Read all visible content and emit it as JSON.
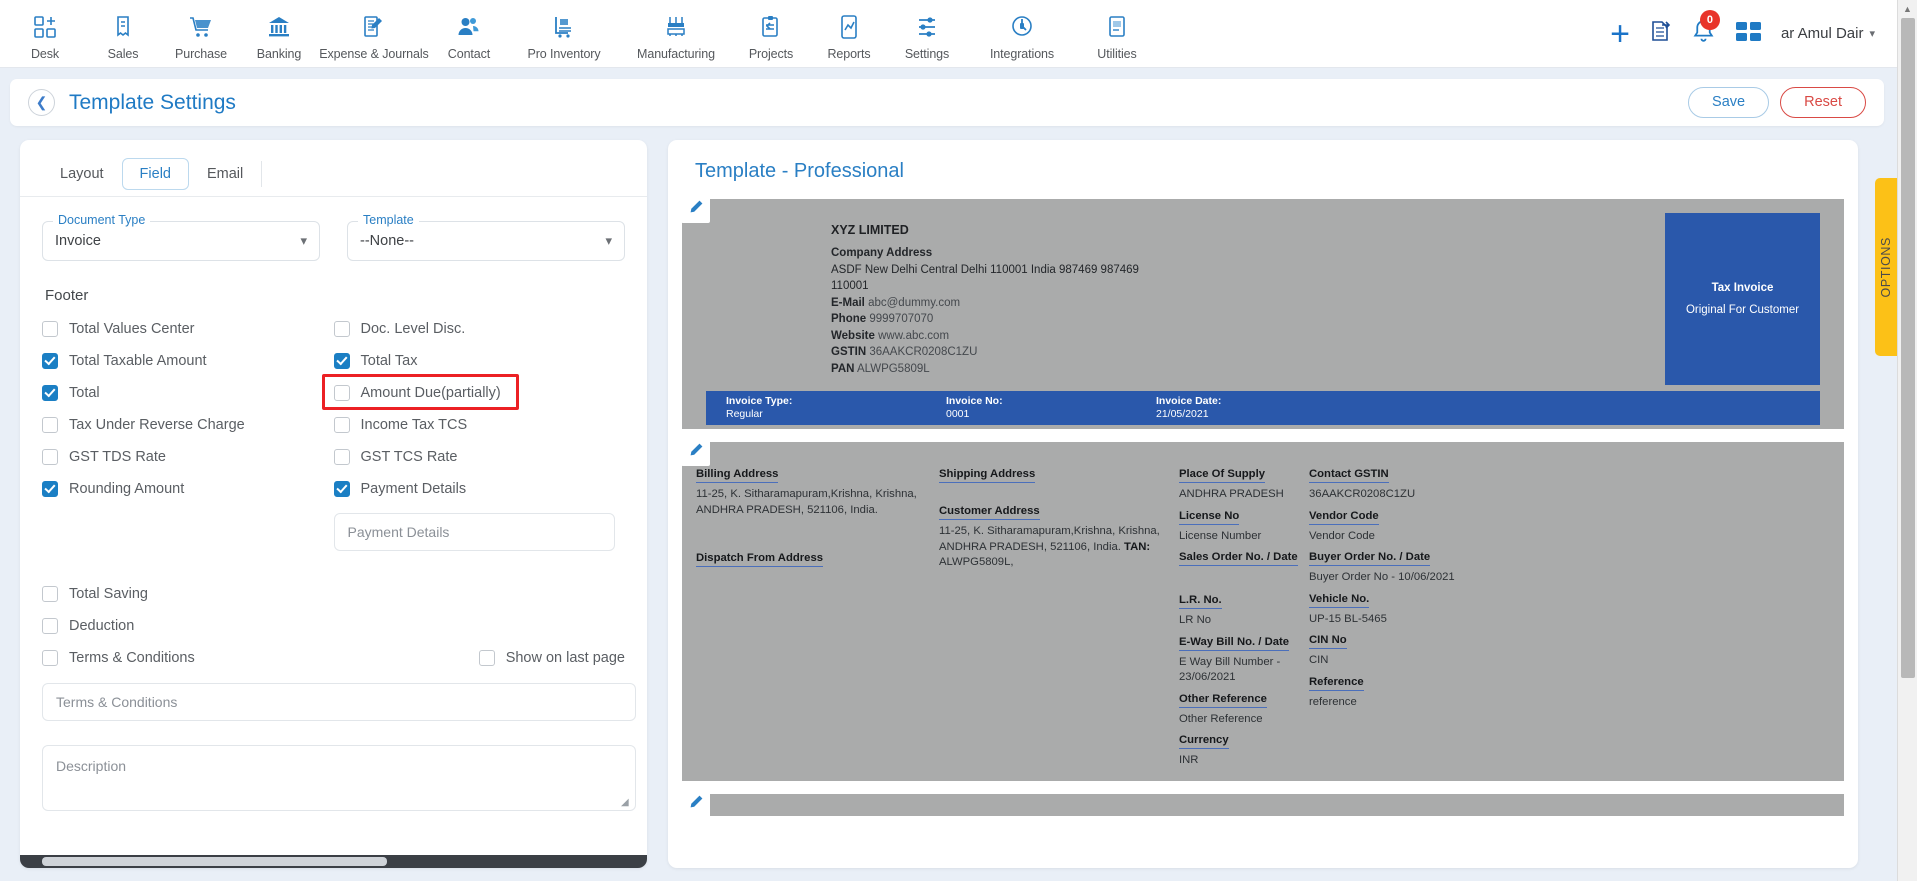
{
  "topnav": {
    "items": [
      {
        "label": "Desk",
        "icon": "desk-icon"
      },
      {
        "label": "Sales",
        "icon": "sales-icon"
      },
      {
        "label": "Purchase",
        "icon": "purchase-cart-icon"
      },
      {
        "label": "Banking",
        "icon": "bank-icon"
      },
      {
        "label": "Expense & Journals",
        "icon": "journal-icon"
      },
      {
        "label": "Contact",
        "icon": "contact-people-icon"
      },
      {
        "label": "Pro Inventory",
        "icon": "inventory-trolley-icon"
      },
      {
        "label": "Manufacturing",
        "icon": "manufacturing-icon"
      },
      {
        "label": "Projects",
        "icon": "projects-clipboard-icon"
      },
      {
        "label": "Reports",
        "icon": "reports-chart-icon"
      },
      {
        "label": "Settings",
        "icon": "settings-sliders-icon"
      },
      {
        "label": "Integrations",
        "icon": "integrations-plug-icon"
      },
      {
        "label": "Utilities",
        "icon": "utilities-icon"
      }
    ],
    "add_label": "+",
    "notification_count": "0",
    "user_name": "ar Amul Dair"
  },
  "header": {
    "title": "Template Settings",
    "save_label": "Save",
    "reset_label": "Reset"
  },
  "left_panel": {
    "tabs": [
      {
        "label": "Layout",
        "active": false
      },
      {
        "label": "Field",
        "active": true
      },
      {
        "label": "Email",
        "active": false
      }
    ],
    "document_type": {
      "legend": "Document Type",
      "value": "Invoice"
    },
    "template": {
      "legend": "Template",
      "value": "--None--"
    },
    "footer_section_title": "Footer",
    "checkboxes_left": [
      {
        "label": "Total Values Center",
        "checked": false
      },
      {
        "label": "Total Taxable Amount",
        "checked": true
      },
      {
        "label": "Total",
        "checked": true
      },
      {
        "label": "Tax Under Reverse Charge",
        "checked": false
      },
      {
        "label": "GST TDS Rate",
        "checked": false
      },
      {
        "label": "Rounding Amount",
        "checked": true
      }
    ],
    "checkboxes_right": [
      {
        "label": "Doc. Level Disc.",
        "checked": false
      },
      {
        "label": "Total Tax",
        "checked": true
      },
      {
        "label": "Amount Due(partially)",
        "checked": false,
        "highlighted": true
      },
      {
        "label": "Income Tax TCS",
        "checked": false
      },
      {
        "label": "GST TCS Rate",
        "checked": false
      },
      {
        "label": "Payment Details",
        "checked": true
      }
    ],
    "payment_details_input": "Payment Details",
    "checkboxes_lower": [
      {
        "label": "Total Saving",
        "checked": false
      },
      {
        "label": "Deduction",
        "checked": false
      },
      {
        "label": "Terms & Conditions",
        "checked": false
      }
    ],
    "show_on_last_page": {
      "label": "Show on last page",
      "checked": false
    },
    "terms_input": "Terms & Conditions",
    "description_input": "Description"
  },
  "preview": {
    "title": "Template - Professional",
    "company": {
      "name": "XYZ LIMITED",
      "address_label": "Company Address",
      "address_line1": "ASDF New Delhi Central Delhi 110001 India 987469 987469",
      "address_line2": "110001",
      "email_label": "E-Mail",
      "email_value": "abc@dummy.com",
      "phone_label": "Phone",
      "phone_value": "9999707070",
      "website_label": "Website",
      "website_value": "www.abc.com",
      "gstin_label": "GSTIN",
      "gstin_value": "36AAKCR0208C1ZU",
      "pan_label": "PAN",
      "pan_value": "ALWPG5809L"
    },
    "tax_box": {
      "line1": "Tax Invoice",
      "line2": "Original For Customer"
    },
    "invoice_bar": [
      {
        "key": "Invoice Type:",
        "value": "Regular"
      },
      {
        "key": "Invoice No:",
        "value": "0001"
      },
      {
        "key": "Invoice Date:",
        "value": "21/05/2021"
      }
    ],
    "billing": {
      "label": "Billing Address",
      "line1": "11-25, K. Sitharamapuram,Krishna, Krishna,",
      "line2": "ANDHRA PRADESH, 521106, India.",
      "dispatch_label": "Dispatch From Address"
    },
    "shipping": {
      "label": "Shipping Address",
      "customer_label": "Customer Address",
      "line1": "11-25, K. Sitharamapuram,Krishna, Krishna,",
      "line2": "ANDHRA PRADESH, 521106, India.",
      "tan_label": "TAN:",
      "tan_value": "ALWPG5809L,"
    },
    "col3": [
      {
        "label": "Place Of Supply",
        "value": "ANDHRA PRADESH"
      },
      {
        "label": "License No",
        "value": "License Number"
      },
      {
        "label": "Sales Order No. / Date",
        "value": ""
      },
      {
        "label": "L.R. No.",
        "value": "LR No"
      },
      {
        "label": "E-Way Bill No. / Date",
        "value": "E Way Bill Number - 23/06/2021"
      },
      {
        "label": "Other Reference",
        "value": "Other Reference"
      },
      {
        "label": "Currency",
        "value": "INR"
      }
    ],
    "col4": [
      {
        "label": "Contact GSTIN",
        "value": "36AAKCR0208C1ZU"
      },
      {
        "label": "Vendor Code",
        "value": "Vendor Code"
      },
      {
        "label": "Buyer Order No. / Date",
        "value": "Buyer Order No - 10/06/2021"
      },
      {
        "label": "Vehicle No.",
        "value": "UP-15 BL-5465"
      },
      {
        "label": "CIN No",
        "value": "CIN"
      },
      {
        "label": "Reference",
        "value": "reference"
      }
    ]
  },
  "options_tab": {
    "label": "OPTIONS"
  }
}
